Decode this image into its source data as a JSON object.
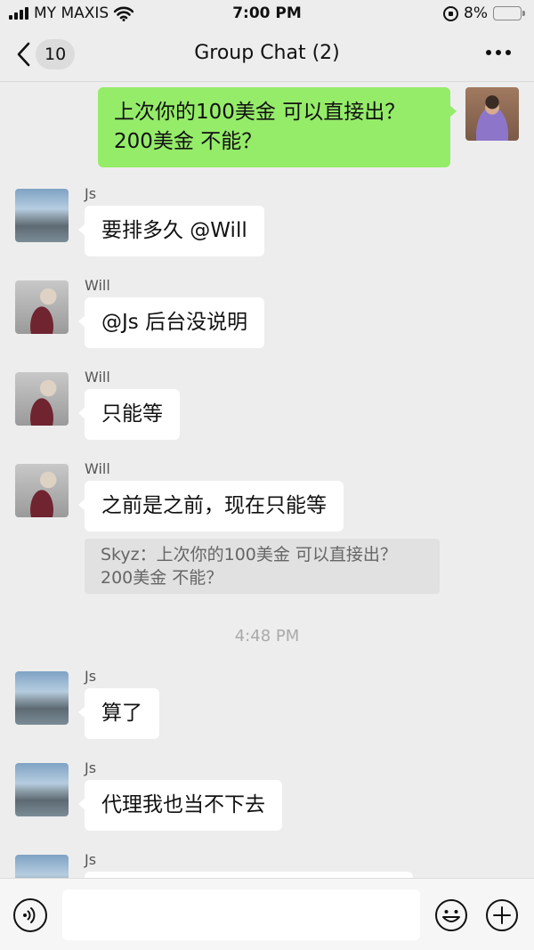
{
  "status_bar": {
    "carrier": "MY MAXIS",
    "time": "7:00 PM",
    "battery": "8%",
    "battery_level": 0.08,
    "icons": [
      "signal-icon",
      "wifi-icon",
      "rotation-lock-icon",
      "battery-icon"
    ]
  },
  "nav": {
    "unread_count": "10",
    "title": "Group Chat (2)",
    "icons": [
      "back-chevron-icon",
      "more-icon"
    ]
  },
  "messages": [
    {
      "sender": "",
      "text": "上次你的100美金 可以直接出？200美金 不能？",
      "self": true
    },
    {
      "sender": "Js",
      "text": "要排多久 @Will"
    },
    {
      "sender": "Will",
      "text": "@Js 后台没说明"
    },
    {
      "sender": "Will",
      "text": "只能等"
    },
    {
      "sender": "Will",
      "text": "之前是之前，现在只能等"
    },
    {
      "quote": "Skyz：上次你的100美金 可以直接出？200美金 不能？"
    },
    {
      "timestamp": "4:48 PM"
    },
    {
      "sender": "Js",
      "text": "算了"
    },
    {
      "sender": "Js",
      "text": "代理我也当不下去"
    },
    {
      "sender": "Js",
      "text": ""
    }
  ],
  "input_bar": {
    "placeholder": "",
    "icons": [
      "voice-icon",
      "emoji-icon",
      "plus-icon"
    ]
  },
  "colors": {
    "self_bubble": "#95ec69",
    "other_bubble": "#ffffff",
    "background": "#ededed",
    "battery_low": "#e0302e"
  }
}
